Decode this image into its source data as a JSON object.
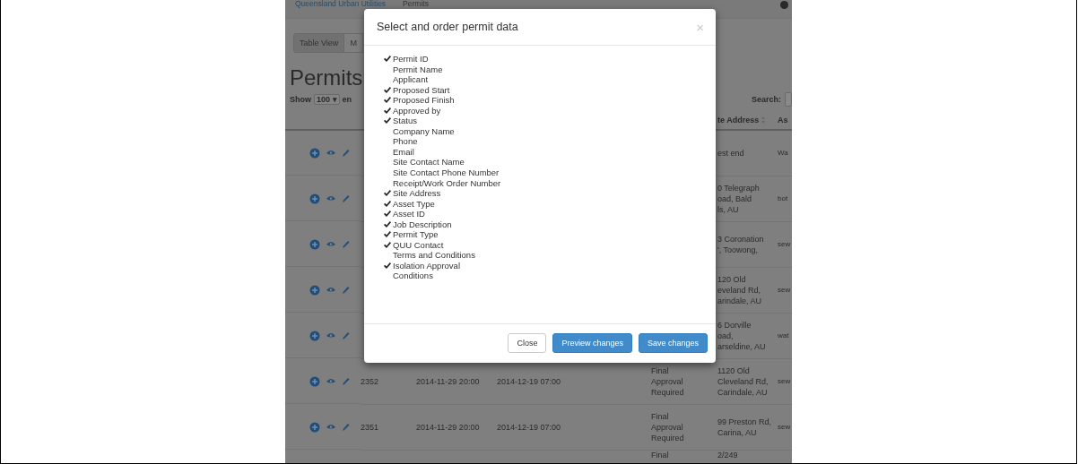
{
  "top_nav": {
    "brand": "Queensland Urban Utilities",
    "links": [
      "Permits"
    ]
  },
  "view_tabs": [
    {
      "label": "Table View",
      "selected": true
    },
    {
      "label": "M",
      "selected": false
    }
  ],
  "heading": "Permits",
  "length_control": {
    "prefix": "Show",
    "value": "100",
    "caret": "▾",
    "suffix": "en"
  },
  "search": {
    "label": "Search:"
  },
  "table": {
    "columns": [
      "te Address",
      "As"
    ],
    "rows": [
      {
        "address": [
          "est end"
        ],
        "asset": "Wa"
      },
      {
        "address": [
          "0 Telegraph",
          "oad, Bald",
          "ls, AU"
        ],
        "asset": "bot"
      },
      {
        "address": [
          "3 Coronation",
          "', Toowong,"
        ],
        "asset": "sew"
      },
      {
        "address": [
          "120 Old",
          "eveland Rd,",
          "arindale, AU"
        ],
        "asset": "sew"
      },
      {
        "address": [
          "6 Dorville",
          "oad,",
          "arseldine, AU"
        ],
        "asset": "wat"
      },
      {
        "id": "2352",
        "start": "2014-11-29 20:00",
        "finish": "2014-12-19 07:00",
        "status": [
          "Final",
          "Approval",
          "Required"
        ],
        "address": [
          "1120 Old",
          "Cleveland Rd,",
          "Carindale, AU"
        ],
        "asset": "sew"
      },
      {
        "id": "2351",
        "start": "2014-11-29 20:00",
        "finish": "2014-12-19 07:00",
        "status": [
          "Final",
          "Approval",
          "Required"
        ],
        "address": [
          "99 Preston Rd,",
          "Carina, AU"
        ],
        "asset": "sew"
      },
      {
        "status": [
          "Final"
        ],
        "address": [
          "2/249"
        ]
      }
    ]
  },
  "modal": {
    "title": "Select and order permit data",
    "close": "×",
    "fields": [
      {
        "label": "Permit ID",
        "checked": true
      },
      {
        "label": "Permit Name",
        "checked": false
      },
      {
        "label": "Applicant",
        "checked": false
      },
      {
        "label": "Proposed Start",
        "checked": true
      },
      {
        "label": "Proposed Finish",
        "checked": true
      },
      {
        "label": "Approved by",
        "checked": true
      },
      {
        "label": "Status",
        "checked": true
      },
      {
        "label": "Company Name",
        "checked": false
      },
      {
        "label": "Phone",
        "checked": false
      },
      {
        "label": "Email",
        "checked": false
      },
      {
        "label": "Site Contact Name",
        "checked": false
      },
      {
        "label": "Site Contact Phone Number",
        "checked": false
      },
      {
        "label": "Receipt/Work Order Number",
        "checked": false
      },
      {
        "label": "Site Address",
        "checked": true
      },
      {
        "label": "Asset Type",
        "checked": true
      },
      {
        "label": "Asset ID",
        "checked": true
      },
      {
        "label": "Job Description",
        "checked": true
      },
      {
        "label": "Permit Type",
        "checked": true
      },
      {
        "label": "QUU Contact",
        "checked": true
      },
      {
        "label": "Terms and Conditions",
        "checked": false
      },
      {
        "label": "Isolation Approval\nConditions",
        "checked": true
      }
    ],
    "buttons": [
      {
        "label": "Close",
        "kind": "default"
      },
      {
        "label": "Preview changes",
        "kind": "primary"
      },
      {
        "label": "Save changes",
        "kind": "primary"
      }
    ]
  }
}
